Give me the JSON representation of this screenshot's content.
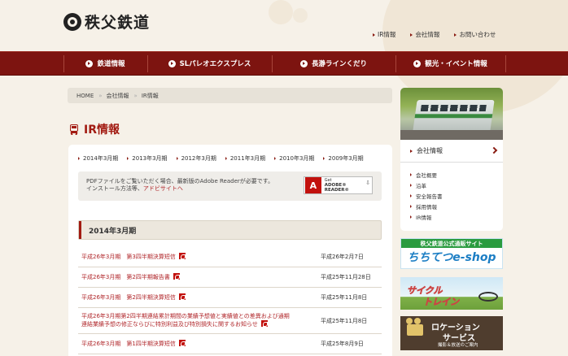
{
  "header": {
    "logo_text": "秩父鉄道",
    "links": [
      "IR情報",
      "会社情報",
      "お問い合わせ"
    ]
  },
  "nav": {
    "items": [
      "鉄道情報",
      "SLパレオエクスプレス",
      "長瀞ラインくだり",
      "観光・イベント情報"
    ]
  },
  "breadcrumb": {
    "items": [
      "HOME",
      "会社情報",
      "IR情報"
    ]
  },
  "page": {
    "title": "IR情報",
    "year_tabs": [
      "2014年3月期",
      "2013年3月期",
      "2012年3月期",
      "2011年3月期",
      "2010年3月期",
      "2009年3月期"
    ],
    "pdf_notice_line1": "PDFファイルをご覧いただく場合、最新版のAdobe Readerが必要です。",
    "pdf_notice_line2_prefix": "インストール方法等、",
    "pdf_notice_link": "アドビサイトへ",
    "adobe_badge_line1": "Get",
    "adobe_badge_line2": "ADOBE® READER®",
    "section_title": "2014年3月期",
    "documents": [
      {
        "title": "平成26年3月期　第3四半期決算短信",
        "date": "平成26年2月7日"
      },
      {
        "title": "平成26年3月期　第2四半期報告書",
        "date": "平成25年11月28日"
      },
      {
        "title": "平成26年3月期　第2四半期決算短信",
        "date": "平成25年11月8日"
      },
      {
        "title": "平成26年3月期第2四半期連結累計期間の業績予想値と実績値との差異および通期連結業績予想の修正ならびに特別利益及び特別損失に関するお知らせ",
        "date": "平成25年11月8日"
      },
      {
        "title": "平成26年3月期　第1四半期決算短信",
        "date": "平成25年8月9日"
      }
    ]
  },
  "sidebar": {
    "section_title": "会社情報",
    "menu": [
      "会社概要",
      "沿革",
      "安全報告書",
      "採用情報",
      "IR情報"
    ],
    "banner1_top": "秩父鉄道公式通販サイト",
    "banner1_main": "ちちてつe-shop",
    "banner2_line1": "サイクル",
    "banner2_line2": "トレイン",
    "banner3_line1": "ロケーション",
    "banner3_line2": "サービス",
    "banner3_line3": "撮影＆放送のご案内"
  }
}
